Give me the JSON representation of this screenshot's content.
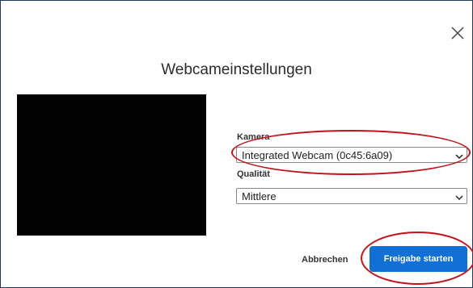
{
  "dialog": {
    "title": "Webcameinstellungen"
  },
  "camera": {
    "label": "Kamera",
    "selected": "Integrated Webcam (0c45:6a09)"
  },
  "quality": {
    "label": "Qualität",
    "selected": "Mittlere"
  },
  "actions": {
    "cancel_label": "Abbrechen",
    "start_label": "Freigabe starten"
  },
  "colors": {
    "primary": "#1170d6",
    "annotation": "#c4121a",
    "preview": "#020202"
  },
  "icons": {
    "close": "close-icon",
    "dropdown": "chevron-down-icon"
  }
}
